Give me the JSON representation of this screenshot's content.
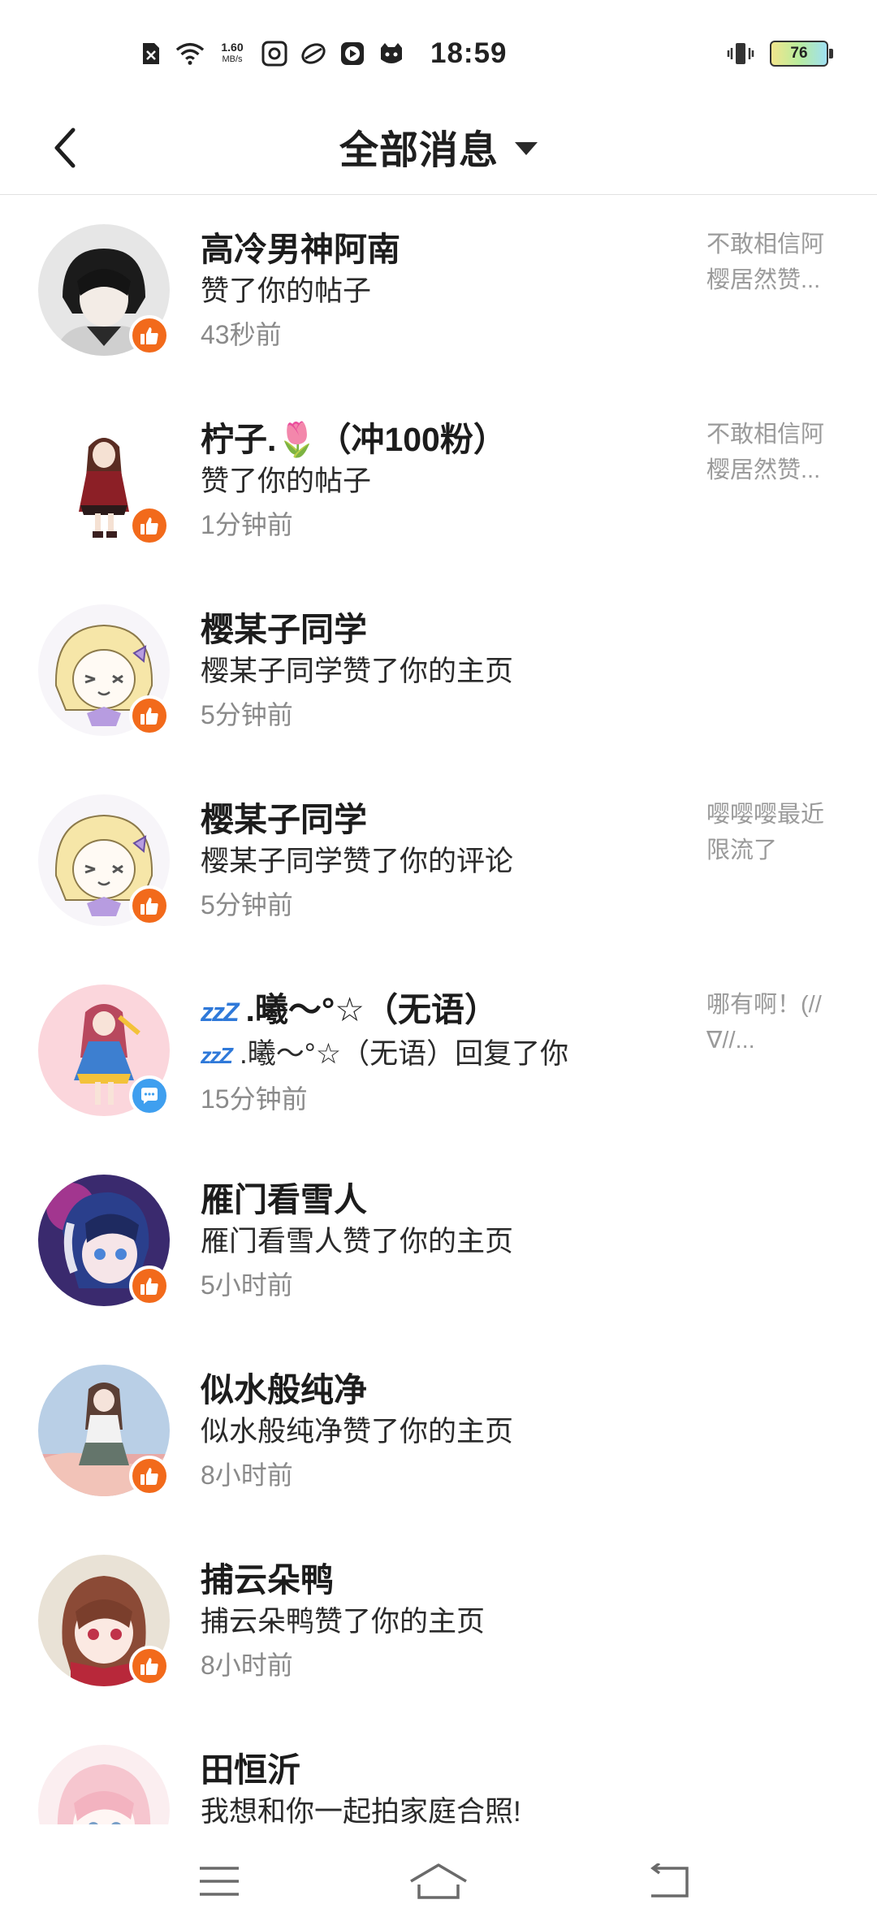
{
  "status_bar": {
    "net_speed_value": "1.60",
    "net_speed_unit": "MB/s",
    "time": "18:59",
    "battery_level": "76"
  },
  "header": {
    "title": "全部消息"
  },
  "messages": [
    {
      "name": "高冷男神阿南",
      "action": "赞了你的帖子",
      "time": "43秒前",
      "preview": "不敢相信阿樱居然赞...",
      "badge": "like"
    },
    {
      "name": "柠子.🌷（冲100粉）",
      "action": "赞了你的帖子",
      "time": "1分钟前",
      "preview": "不敢相信阿樱居然赞...",
      "badge": "like"
    },
    {
      "name": "樱某子同学",
      "action": "樱某子同学赞了你的主页",
      "time": "5分钟前",
      "preview": "",
      "badge": "like"
    },
    {
      "name": "樱某子同学",
      "action": "樱某子同学赞了你的评论",
      "time": "5分钟前",
      "preview": "嘤嘤嘤最近限流了",
      "badge": "like"
    },
    {
      "name_prefix": "zzZ",
      "name": ".曦～°☆（无语）",
      "action_prefix": "zzZ",
      "action": ".曦～°☆（无语）回复了你",
      "time": "15分钟前",
      "preview": "哪有啊！(//∇//...",
      "badge": "reply"
    },
    {
      "name": "雁门看雪人",
      "action": "雁门看雪人赞了你的主页",
      "time": "5小时前",
      "preview": "",
      "badge": "like"
    },
    {
      "name": "似水般纯净",
      "action": "似水般纯净赞了你的主页",
      "time": "8小时前",
      "preview": "",
      "badge": "like"
    },
    {
      "name": "捕云朵鸭",
      "action": "捕云朵鸭赞了你的主页",
      "time": "8小时前",
      "preview": "",
      "badge": "like"
    },
    {
      "name": "田恒沂",
      "action": "我想和你一起拍家庭合照!",
      "time": "",
      "preview": "",
      "badge": ""
    }
  ],
  "icons": {
    "back": "chevron-left-icon",
    "dropdown": "caret-down-icon",
    "like_badge": "thumbs-up-icon",
    "reply_badge": "chat-bubble-icon",
    "nav_menu": "menu-icon",
    "nav_home": "home-icon",
    "nav_back": "return-icon"
  },
  "colors": {
    "like_badge": "#f26a1b",
    "reply_badge": "#3f9fef",
    "secondary_text": "#8a8a8a"
  }
}
